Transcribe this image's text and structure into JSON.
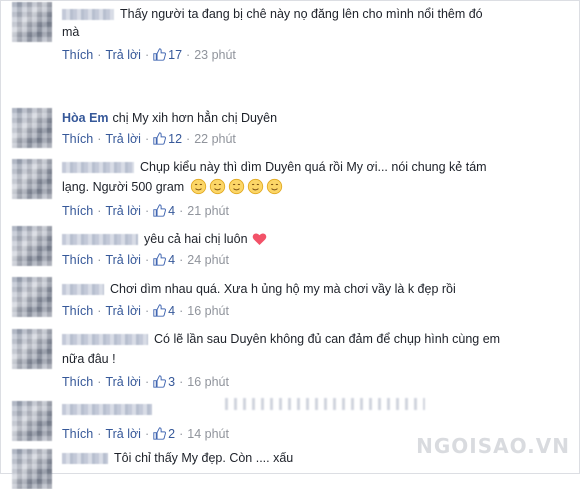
{
  "actions": {
    "like": "Thích",
    "reply": "Trả lời",
    "sep": "·"
  },
  "comments": [
    {
      "author": "",
      "line1": "Thấy người ta đang bị chê này nọ đăng lên cho mình nổi thêm đó",
      "line2": "mà",
      "likes": "17",
      "time": "23 phút"
    },
    {
      "author": "Hòa Em",
      "line1": "chị My xih hơn hẳn chị Duyên",
      "likes": "12",
      "time": "22 phút"
    },
    {
      "author": "",
      "line1": "Chụp kiểu này thì dìm Duyên quá rồi My ơi... nói chung kẻ tám",
      "line2": "lạng. Người 500 gram",
      "likes": "4",
      "time": "21 phút"
    },
    {
      "author": "",
      "line1": "yêu cả hai chị luôn",
      "likes": "4",
      "time": "24 phút"
    },
    {
      "author": "",
      "line1": "Chơi dìm nhau quá. Xưa h ủng hộ my mà chơi vầy là k đẹp rồi",
      "likes": "4",
      "time": "16 phút"
    },
    {
      "author": "",
      "line1": "Có lẽ lần sau Duyên không đủ can đảm để chụp hình cùng em",
      "line2": "nữa đâu !",
      "likes": "3",
      "time": "16 phút"
    },
    {
      "author": "",
      "line1": "",
      "likes": "2",
      "time": "14 phút"
    },
    {
      "author": "",
      "line1": "Tôi chỉ thấy My đẹp. Còn .... xấu"
    }
  ],
  "watermark": "NGOISAO.VN",
  "colors": {
    "link": "#365899",
    "muted": "#90949c",
    "text": "#1d2129"
  }
}
